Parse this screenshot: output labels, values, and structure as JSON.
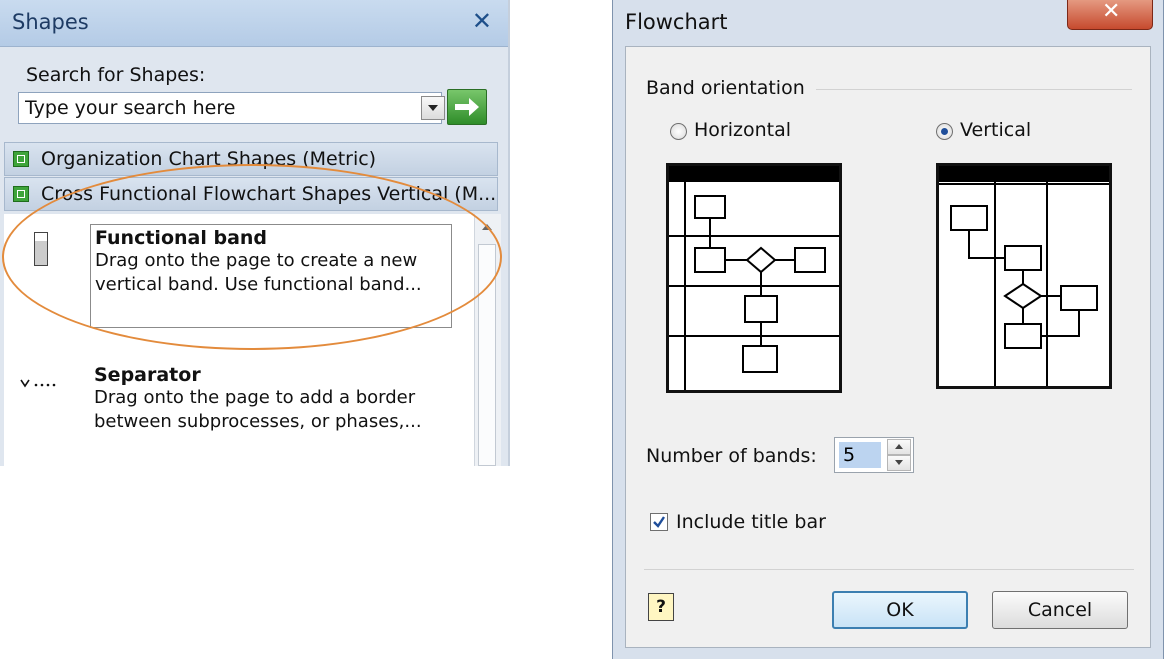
{
  "shapes_panel": {
    "title": "Shapes",
    "search_label": "Search for Shapes:",
    "search_placeholder": "Type your search here",
    "stencils": [
      {
        "label": "Organization Chart Shapes (Metric)"
      },
      {
        "label": "Cross Functional Flowchart Shapes Vertical (M..."
      }
    ],
    "items": [
      {
        "title": "Functional band",
        "desc1": "Drag onto the page to create a new",
        "desc2": "vertical band. Use functional band..."
      },
      {
        "title": "Separator",
        "desc1": "Drag onto the page to add a border",
        "desc2": "between subprocesses, or phases,..."
      }
    ]
  },
  "dialog": {
    "title": "Flowchart",
    "group_label": "Band orientation",
    "horizontal_label": "Horizontal",
    "vertical_label": "Vertical",
    "selected_orientation": "Vertical",
    "bands_label": "Number of bands:",
    "bands_value": "5",
    "include_title_label": "Include title bar",
    "include_title_checked": true,
    "ok_label": "OK",
    "cancel_label": "Cancel",
    "help_label": "?"
  },
  "icons": [
    "close-icon",
    "dropdown-icon",
    "go-arrow-icon",
    "stencil-icon",
    "functional-band-icon",
    "separator-icon",
    "help-icon"
  ],
  "colors": {
    "highlight": "#e38b3c",
    "accent": "#1f4e9a"
  }
}
